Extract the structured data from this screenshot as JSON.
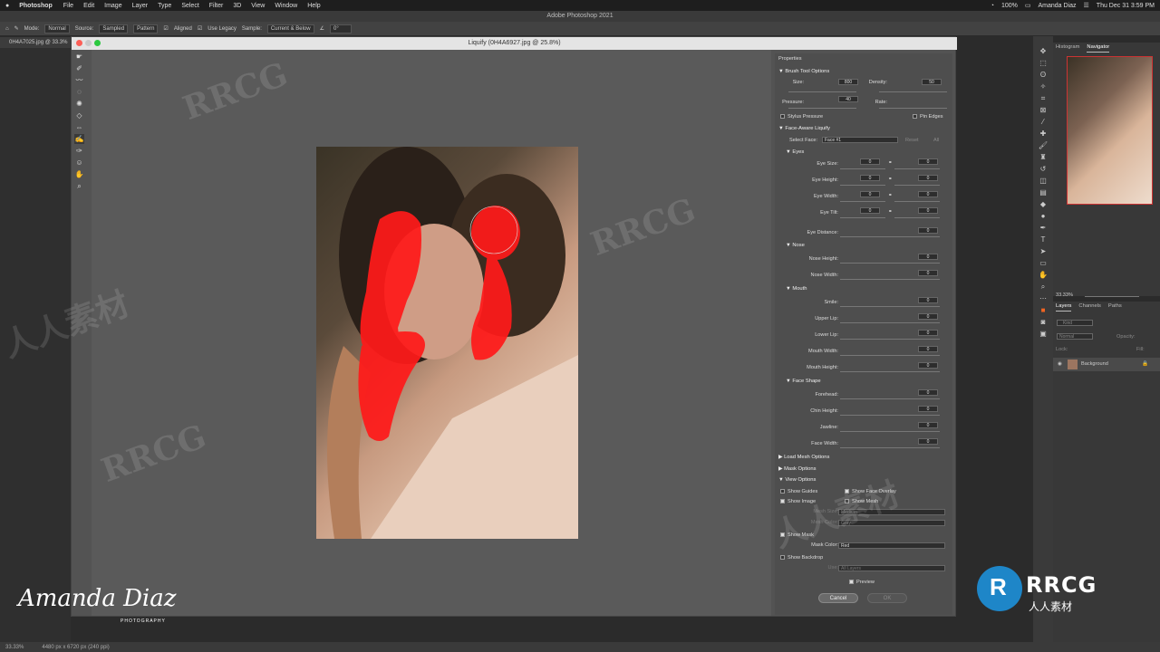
{
  "menubar": {
    "apple": "",
    "app": "Photoshop",
    "items": [
      "File",
      "Edit",
      "Image",
      "Layer",
      "Type",
      "Select",
      "Filter",
      "3D",
      "View",
      "Window",
      "Help"
    ],
    "battery": "100%",
    "user": "Amanda Diaz",
    "datetime": "Thu Dec 31  3:59 PM"
  },
  "window_title": "Adobe Photoshop 2021",
  "options": {
    "mode_label": "Mode:",
    "mode_value": "Normal",
    "source_label": "Source:",
    "sampled": "Sampled",
    "pattern": "Pattern",
    "aligned": "Aligned",
    "use_legacy": "Use Legacy",
    "sample_label": "Sample:",
    "sample_value": "Current & Below",
    "angle": "0°"
  },
  "doc_tab": "0H4A7025.jpg @ 33.3%",
  "dialog": {
    "title": "Liquify (0H4A6927.jpg @ 25.8%)"
  },
  "properties": {
    "title": "Properties",
    "brush": {
      "header": "Brush Tool Options",
      "size_label": "Size:",
      "size": "800",
      "density_label": "Density:",
      "density": "50",
      "pressure_label": "Pressure:",
      "pressure": "40",
      "rate_label": "Rate:",
      "stylus": "Stylus Pressure",
      "pin_edges": "Pin Edges"
    },
    "face": {
      "header": "Face-Aware Liquify",
      "select_face_label": "Select Face:",
      "select_face": "Face #1",
      "reset": "Reset",
      "all": "All"
    },
    "eyes": {
      "header": "Eyes",
      "rows": [
        {
          "label": "Eye Size:",
          "l": "0",
          "r": "0"
        },
        {
          "label": "Eye Height:",
          "l": "0",
          "r": "0"
        },
        {
          "label": "Eye Width:",
          "l": "0",
          "r": "0"
        },
        {
          "label": "Eye Tilt:",
          "l": "0",
          "r": "0"
        }
      ],
      "distance_label": "Eye Distance:",
      "distance": "0"
    },
    "nose": {
      "header": "Nose",
      "rows": [
        {
          "label": "Nose Height:",
          "v": "0"
        },
        {
          "label": "Nose Width:",
          "v": "0"
        }
      ]
    },
    "mouth": {
      "header": "Mouth",
      "rows": [
        {
          "label": "Smile:",
          "v": "0"
        },
        {
          "label": "Upper Lip:",
          "v": "0"
        },
        {
          "label": "Lower Lip:",
          "v": "0"
        },
        {
          "label": "Mouth Width:",
          "v": "0"
        },
        {
          "label": "Mouth Height:",
          "v": "0"
        }
      ]
    },
    "faceshape": {
      "header": "Face Shape",
      "rows": [
        {
          "label": "Forehead:",
          "v": "0"
        },
        {
          "label": "Chin Height:",
          "v": "0"
        },
        {
          "label": "Jawline:",
          "v": "0"
        },
        {
          "label": "Face Width:",
          "v": "0"
        }
      ]
    },
    "load_mesh": "Load Mesh Options",
    "mask_options": "Mask Options",
    "view": {
      "header": "View Options",
      "show_guides": "Show Guides",
      "show_face_overlay": "Show Face Overlay",
      "show_image": "Show Image",
      "show_mesh": "Show Mesh",
      "mesh_size_label": "Mesh Size:",
      "mesh_size": "Medium",
      "mesh_color_label": "Mesh Color:",
      "mesh_color": "Gray",
      "show_mask": "Show Mask",
      "mask_color_label": "Mask Color:",
      "mask_color": "Red",
      "show_backdrop": "Show Backdrop",
      "use_label": "Use:",
      "use_value": "All Layers"
    },
    "preview": "Preview",
    "cancel": "Cancel",
    "ok": "OK"
  },
  "panels": {
    "histogram": "Histogram",
    "navigator": "Navigator",
    "zoom": "33.33%",
    "layers": "Layers",
    "channels": "Channels",
    "paths": "Paths",
    "kind": "Kind",
    "blend": "Normal",
    "opacity": "Opacity:",
    "lock": "Lock:",
    "fill": "Fill:",
    "background": "Background"
  },
  "status": {
    "zoom": "33.33%",
    "dims": "4480 px x 6720 px (240 ppi)"
  },
  "watermark": {
    "brand": "RRCG",
    "cn": "人人素材",
    "logo": "R"
  },
  "signature": {
    "name": "Amanda Diaz",
    "sub": "PHOTOGRAPHY"
  },
  "colors": {
    "mask": "#ff1a1a",
    "accent": "#1e86c8"
  }
}
